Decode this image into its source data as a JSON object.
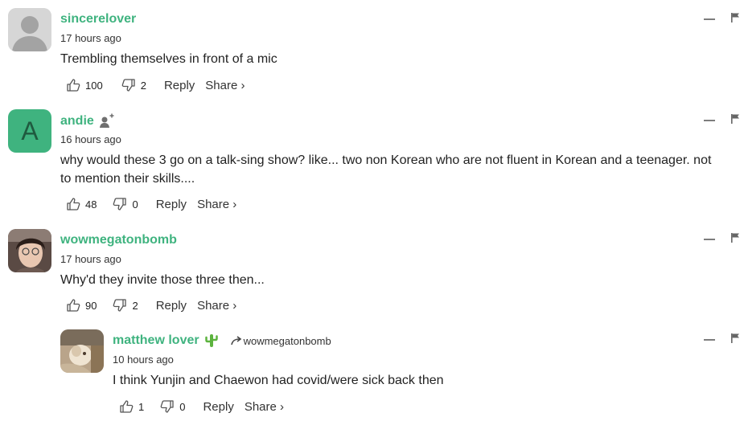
{
  "comments": [
    {
      "username": "sincerelover",
      "time": "17 hours ago",
      "text": "Trembling themselves in front of a mic",
      "likes": "100",
      "dislikes": "2",
      "reply": "Reply",
      "share": "Share ›",
      "avatar": "default-user"
    },
    {
      "username": "andie",
      "avatar_letter": "A",
      "time": "16 hours ago",
      "text": "why would these 3 go on a talk-sing show? like... two non Korean who are not fluent in Korean and a teenager. not to mention their skills....",
      "likes": "48",
      "dislikes": "0",
      "reply": "Reply",
      "share": "Share ›",
      "badge_icon": "add-follower-icon"
    },
    {
      "username": "wowmegatonbomb",
      "time": "17 hours ago",
      "text": "Why'd they invite those three then...",
      "likes": "90",
      "dislikes": "2",
      "reply": "Reply",
      "share": "Share ›",
      "avatar": "photo"
    },
    {
      "username": "matthew lover",
      "badge_icon": "cactus-icon",
      "reply_to": "wowmegatonbomb",
      "time": "10 hours ago",
      "text": "I think Yunjin and Chaewon had covid/were sick back then",
      "likes": "1",
      "dislikes": "0",
      "reply": "Reply",
      "share": "Share ›",
      "avatar": "photo"
    }
  ],
  "colors": {
    "username": "#3fb37f",
    "avatar_letter_bg": "#3fb37f",
    "default_avatar_bg": "#d6d6d6",
    "icon_gray": "#7d7d7d"
  }
}
